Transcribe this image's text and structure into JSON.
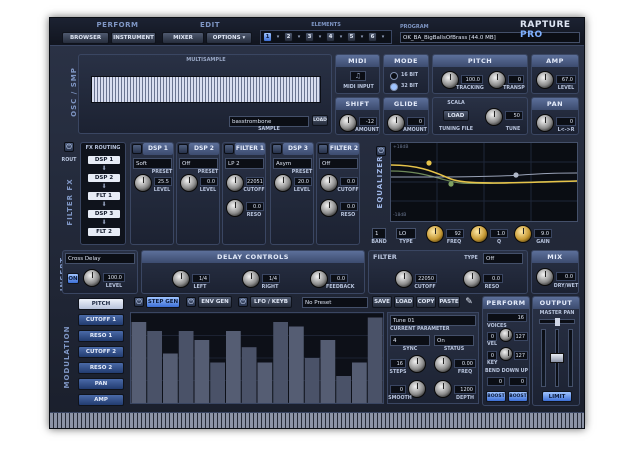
{
  "header": {
    "perform_title": "PERFORM",
    "browser": "BROWSER",
    "instrument": "INSTRUMENT",
    "edit_title": "EDIT",
    "mixer": "MIXER",
    "options": "OPTIONS ▾",
    "elements_title": "ELEMENTS",
    "elements": [
      "1",
      "2",
      "3",
      "4",
      "5",
      "6"
    ],
    "program_title": "PROGRAM",
    "program_name": "OK_BA_BigBallsOfBrass [44.0 MB]",
    "logo_main": "RAPTURE",
    "logo_pro": "PRO"
  },
  "osc": {
    "title": "OSC / SMP",
    "multisample_title": "MULTISAMPLE",
    "sample_name": "basstrombone",
    "sample_label": "SAMPLE",
    "load": "LOAD",
    "midi_title": "MIDI",
    "midi_input": "MIDI INPUT",
    "mode_title": "MODE",
    "bit16": "16 BIT",
    "bit32": "32 BIT",
    "pitch_title": "PITCH",
    "tracking_value": "100.0",
    "tracking": "TRACKING",
    "transp_value": "0",
    "transp": "TRANSP",
    "amp_title": "AMP",
    "amp_value": "67.0",
    "level": "LEVEL",
    "shift_title": "SHIFT",
    "shift_value": "-12",
    "amount": "AMOUNT",
    "glide_title": "GLIDE",
    "glide_value": "0",
    "scala": "SCALA",
    "scala_load": "LOAD",
    "tuning_file": "TUNING FILE",
    "tune_value": "50",
    "tune": "TUNE",
    "pan_title": "PAN",
    "pan_value": "0",
    "pan_lr": "L<->R"
  },
  "filterfx": {
    "title": "FILTER FX",
    "route": "ROUT",
    "routing_title": "FX ROUTING",
    "routing": [
      "DSP 1",
      "DSP 2",
      "FLT 1",
      "DSP 3",
      "FLT 2"
    ],
    "dsp1": {
      "title": "DSP 1",
      "type": "Soft",
      "value": "25.5",
      "preset": "PRESET",
      "level": "LEVEL"
    },
    "dsp2": {
      "title": "DSP 2",
      "type": "Off",
      "value": "0.0",
      "preset": "PRESET",
      "level": "LEVEL"
    },
    "filter1": {
      "title": "FILTER 1",
      "type": "LP 2",
      "cutoff_value": "22051",
      "cutoff": "CUTOFF",
      "reso_value": "0.0",
      "reso": "RESO"
    },
    "dsp3": {
      "title": "DSP 3",
      "type": "Asym",
      "value": "20.0",
      "preset": "PRESET",
      "level": "LEVEL"
    },
    "filter2": {
      "title": "FILTER 2",
      "type": "Off",
      "cutoff_value": "0.0",
      "cutoff": "CUTOFF",
      "reso_value": "0.0",
      "reso": "RESO"
    }
  },
  "eq": {
    "title": "EQUALIZER",
    "db_top": "+18dB",
    "db_bottom": "-18dB",
    "band_value": "1",
    "band": "BAND",
    "type_value": "LO",
    "type": "TYPE",
    "freq_value": "92",
    "freq": "FREQ",
    "q_value": "1.0",
    "q": "Q",
    "gain_value": "9.0",
    "gain": "GAIN"
  },
  "insert": {
    "title": "INSERT",
    "effect": "Cross Delay",
    "on": "ON",
    "level_value": "100.0",
    "level": "LEVEL",
    "delay_title": "DELAY CONTROLS",
    "left_value": "1/4",
    "left": "LEFT",
    "right_value": "1/4",
    "right": "RIGHT",
    "feedback_value": "0.0",
    "feedback": "FEEDBACK",
    "filter_title": "FILTER",
    "filter_type": "Off",
    "type": "TYPE",
    "cutoff_value": "22050",
    "cutoff": "CUTOFF",
    "reso_value": "0.0",
    "reso": "RESO",
    "mix_title": "MIX",
    "mix_value": "0.0",
    "drywet": "DRY/WET"
  },
  "modulation": {
    "title": "MODULATION",
    "targets": [
      "PITCH",
      "CUTOFF 1",
      "RESO 1",
      "CUTOFF 2",
      "RESO 2",
      "PAN",
      "AMP"
    ],
    "step_gen": "STEP GEN",
    "env_gen": "ENV GEN",
    "lfo_keyb": "LFO / KEYB",
    "preset": "No Preset",
    "save": "SAVE",
    "load": "LOAD",
    "copy": "COPY",
    "paste": "PASTE",
    "steps": [
      0.9,
      0.8,
      0.55,
      0.8,
      0.7,
      0.45,
      0.8,
      0.62,
      0.45,
      0.9,
      0.85,
      0.5,
      0.7,
      0.3,
      0.45,
      0.95
    ],
    "tune_field": "Tune 01",
    "current_param": "CURRENT PARAMETER",
    "sync_value": "4",
    "sync": "SYNC",
    "status_value": "On",
    "status": "STATUS",
    "steps_value": "16",
    "steps_label": "STEPS",
    "freq_value": "0.00",
    "freq": "FREQ",
    "smooth_value": "0",
    "smooth": "SMOOTH",
    "depth_value": "1200",
    "depth": "DEPTH"
  },
  "perform": {
    "title": "PERFORM",
    "voices_value": "16",
    "voices": "VOICES",
    "vel_a": "0",
    "vel_b": "127",
    "vel": "VEL",
    "key_a": "0",
    "key_b": "127",
    "key": "KEY",
    "bend_title": "BEND DOWN  UP",
    "bend_down": "0",
    "bend_up": "0",
    "boost": "BOOST",
    "boost2": "BOOST"
  },
  "output": {
    "title": "OUTPUT",
    "master_pan": "MASTER PAN",
    "limit": "LIMIT"
  },
  "colors": {
    "accent": "#9fc4ff",
    "panel": "#293145",
    "eq_curve": "#e6c34a"
  }
}
